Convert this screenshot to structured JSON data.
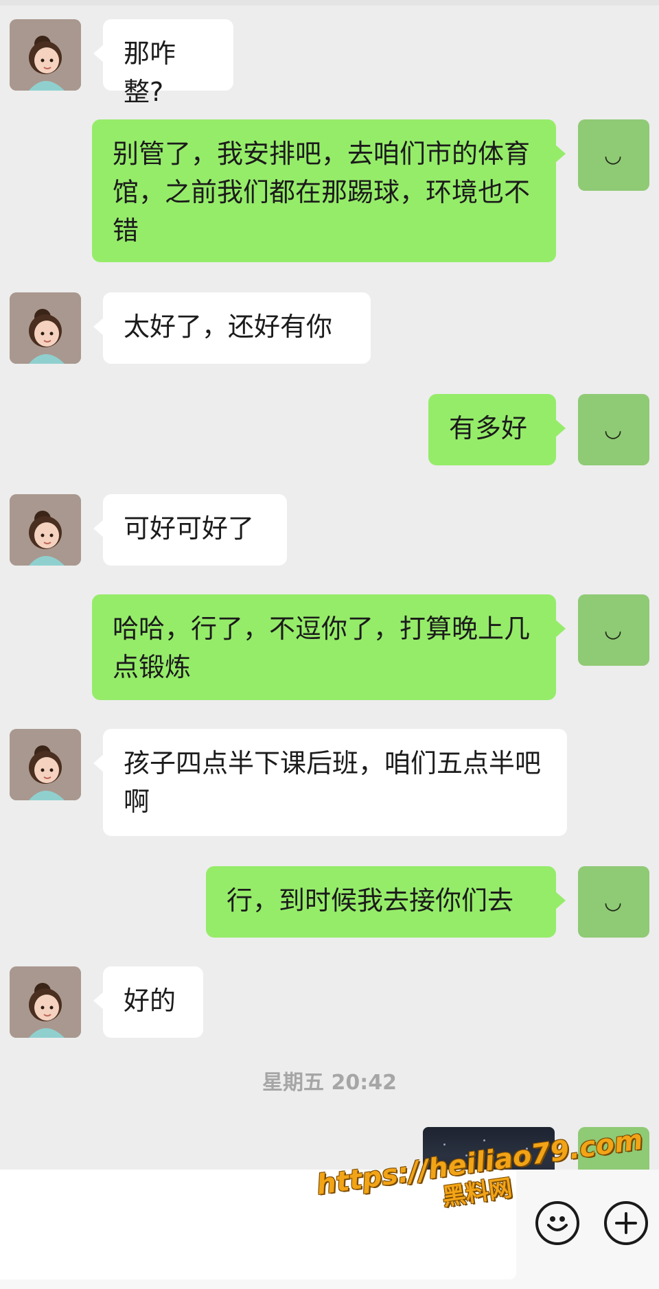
{
  "messages": [
    {
      "side": "left",
      "text": "那咋整?"
    },
    {
      "side": "right",
      "text": "别管了，我安排吧，去咱们市的体育馆，之前我们都在那踢球，环境也不错"
    },
    {
      "side": "left",
      "text": "太好了，还好有你"
    },
    {
      "side": "right",
      "text": "有多好"
    },
    {
      "side": "left",
      "text": "可好可好了"
    },
    {
      "side": "right",
      "text": "哈哈，行了，不逗你了，打算晚上几点锻炼"
    },
    {
      "side": "left",
      "text": "孩子四点半下课后班，咱们五点半吧啊"
    },
    {
      "side": "right",
      "text": "行，到时候我去接你们去"
    },
    {
      "side": "left",
      "text": "好的"
    }
  ],
  "timestamp": "星期五 20:42",
  "my_avatar_text": "◡",
  "watermark": {
    "url": "https://heiliao79.com",
    "text": "黑料网"
  },
  "colors": {
    "background": "#ededed",
    "my_bubble": "#95ec69",
    "their_bubble": "#ffffff",
    "watermark": "#f2a417"
  }
}
